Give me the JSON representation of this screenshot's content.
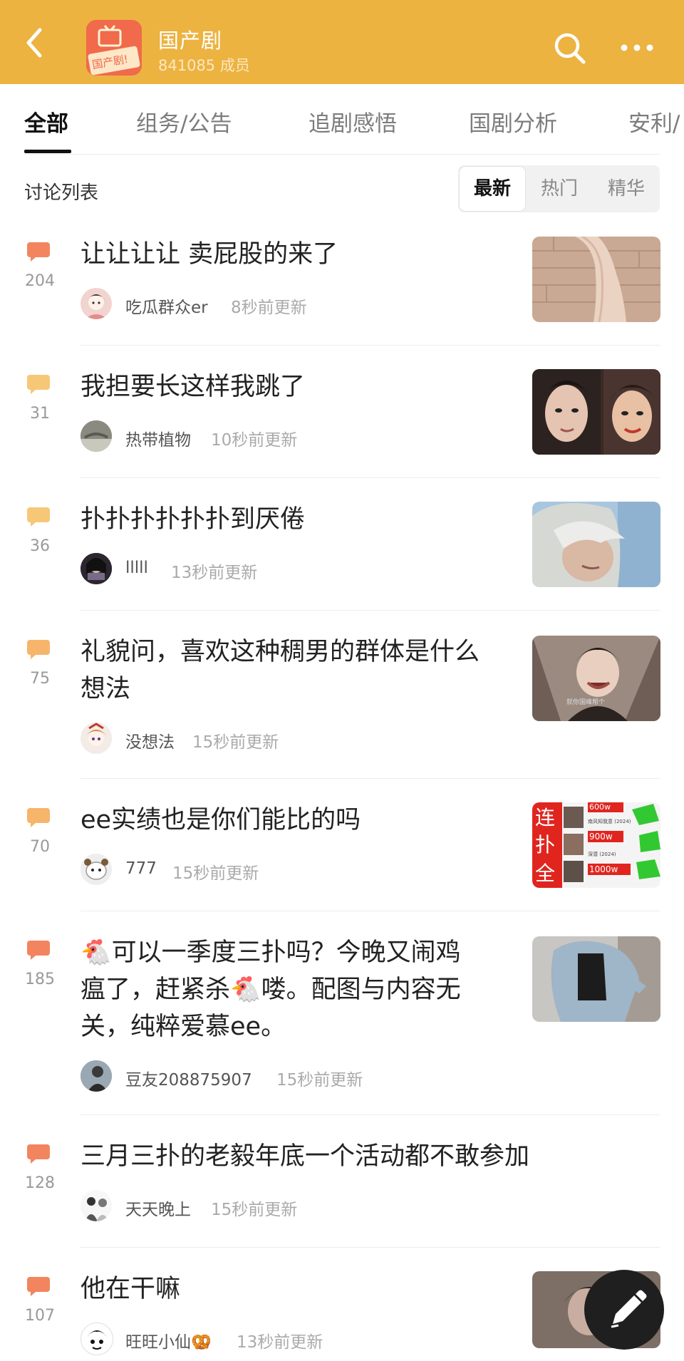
{
  "header": {
    "group_name": "国产剧",
    "member_line": "841085 成员",
    "logo_text": "国产剧!"
  },
  "tabs": [
    {
      "label": "全部"
    },
    {
      "label": "组务/公告"
    },
    {
      "label": "追剧感悟"
    },
    {
      "label": "国剧分析"
    },
    {
      "label": "安利/"
    }
  ],
  "list_title": "讨论列表",
  "sort_options": [
    {
      "label": "最新"
    },
    {
      "label": "热门"
    },
    {
      "label": "精华"
    }
  ],
  "posts": [
    {
      "count": "204",
      "title": "让让让让 卖屁股的来了",
      "author": "吃瓜群众er",
      "time": "8秒前更新"
    },
    {
      "count": "31",
      "title": "我担要长这样我跳了",
      "author": "热带植物",
      "time": "10秒前更新"
    },
    {
      "count": "36",
      "title": "扑扑扑扑扑扑到厌倦",
      "author": "lllll",
      "time": "13秒前更新"
    },
    {
      "count": "75",
      "title_line1": "礼貌问，喜欢这种稠男的群体是什么",
      "title_line2": "想法",
      "author": "没想法",
      "time": "15秒前更新"
    },
    {
      "count": "70",
      "title": "ee实绩也是你们能比的吗",
      "author": "777",
      "time": "15秒前更新"
    },
    {
      "count": "185",
      "title_line1": "🐔可以一季度三扑吗？今晚又闹鸡",
      "title_line2": "瘟了，赶紧杀🐔喽。配图与内容无",
      "title_line3": "关，纯粹爱慕ee。",
      "author": "豆友208875907",
      "time": "15秒前更新"
    },
    {
      "count": "128",
      "title": "三月三扑的老毅年底一个活动都不敢参加",
      "author": "天天晚上",
      "time": "15秒前更新"
    },
    {
      "count": "107",
      "title": "他在干嘛",
      "author": "旺旺小仙🥨",
      "time": "13秒前更新"
    }
  ],
  "thumb_text": {
    "t5_a": "连",
    "t5_b": "扑",
    "t5_c": "全",
    "t5_d": "600w",
    "t5_e": "900w",
    "t5_f": "1000w",
    "t5_g": "南风知我意 (2024)",
    "t5_h": "深潜 (2024)",
    "t4_caption": "就你国峰帮个"
  },
  "colors": {
    "header_bg": "#ecb341",
    "bubble_dark": "#f2855f",
    "bubble_light": "#f7c778",
    "fab_bg": "#1f1f1f"
  }
}
